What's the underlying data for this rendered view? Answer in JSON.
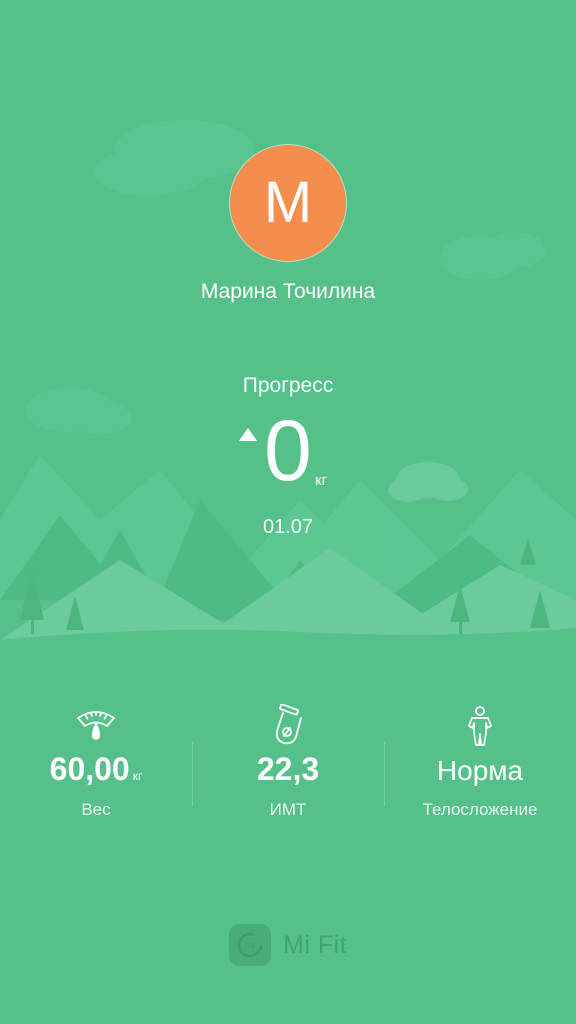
{
  "profile": {
    "avatar_letter": "M",
    "name": "Марина Точилина",
    "avatar_color": "#f58d4c"
  },
  "progress": {
    "label": "Прогресс",
    "value": "0",
    "unit": "кг",
    "date": "01.07",
    "direction_icon": "triangle-up-icon"
  },
  "stats": [
    {
      "icon": "scale-icon",
      "value": "60,00",
      "unit": "кг",
      "label": "Вес"
    },
    {
      "icon": "bmi-icon",
      "value": "22,3",
      "unit": "",
      "label": "ИМТ"
    },
    {
      "icon": "body-type-icon",
      "value": "Норма",
      "unit": "",
      "label": "Телосложение"
    }
  ],
  "footer": {
    "brand": "Mi Fit",
    "logo_text": "mi"
  },
  "colors": {
    "background": "#55c08a",
    "hills_dark": "#4db67f",
    "hills_light": "#6ccb9c",
    "accent": "#f58d4c"
  }
}
